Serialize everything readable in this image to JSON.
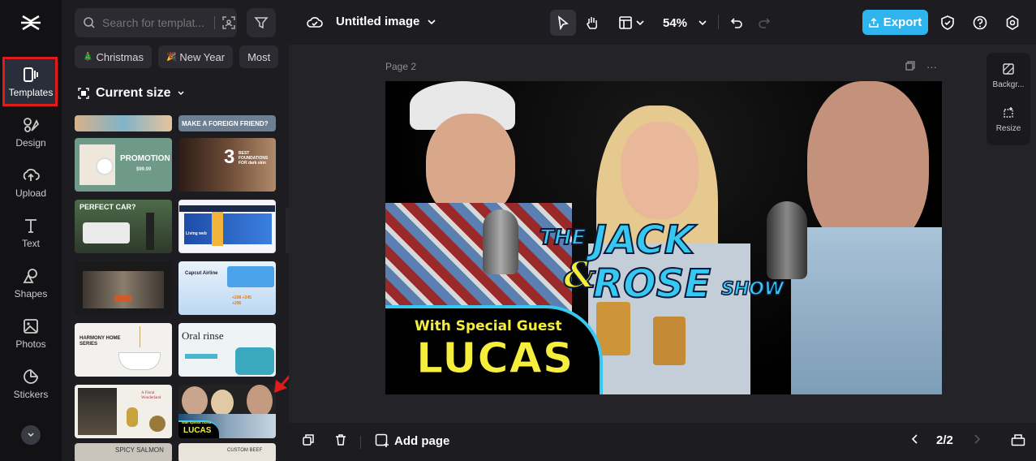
{
  "sidebar": {
    "items": [
      {
        "label": "Templates",
        "icon": "templates-icon"
      },
      {
        "label": "Design",
        "icon": "design-icon"
      },
      {
        "label": "Upload",
        "icon": "upload-icon"
      },
      {
        "label": "Text",
        "icon": "text-icon"
      },
      {
        "label": "Shapes",
        "icon": "shapes-icon"
      },
      {
        "label": "Photos",
        "icon": "photos-icon"
      },
      {
        "label": "Stickers",
        "icon": "stickers-icon"
      }
    ]
  },
  "panel": {
    "search_placeholder": "Search for templat...",
    "chips": [
      {
        "label": "Christmas",
        "emoji": "🎄"
      },
      {
        "label": "New Year",
        "emoji": "🎉"
      },
      {
        "label": "Most",
        "emoji": ""
      }
    ],
    "current_size": "Current size",
    "thumbnails": [
      {
        "text": "",
        "sub": ""
      },
      {
        "text": "MAKE A FOREIGN FRIEND?",
        "sub": ""
      },
      {
        "text": "PROMOTION",
        "sub": "$99.99"
      },
      {
        "text": "3",
        "sub": "BEST FOUNDATIONS FOR dark skin"
      },
      {
        "text": "PERFECT CAR?",
        "sub": ""
      },
      {
        "text": "Living web",
        "sub": ""
      },
      {
        "text": "",
        "sub": ""
      },
      {
        "text": "Capcut Airline",
        "sub": "+208 +245 +296"
      },
      {
        "text": "HARMONY HOME SERIES",
        "sub": ""
      },
      {
        "text": "Oral rinse",
        "sub": ""
      },
      {
        "text": "A Floral Wonderland",
        "sub": ""
      },
      {
        "text": "LUCAS",
        "sub": "With Special Guest"
      },
      {
        "text": "SPICY SALMON",
        "sub": ""
      },
      {
        "text": "CUSTOM BEEF",
        "sub": ""
      }
    ]
  },
  "topbar": {
    "title": "Untitled image",
    "zoom": "54%",
    "export_label": "Export"
  },
  "canvas": {
    "page_label": "Page 2",
    "artboard": {
      "title_the": "THE",
      "title_jack": "JACK",
      "title_amp": "&",
      "title_rose": "ROSE",
      "title_show": "SHOW",
      "guest_line": "With Special Guest",
      "guest_name": "LUCAS"
    },
    "side_tools": [
      {
        "label": "Backgr...",
        "icon": "background-icon"
      },
      {
        "label": "Resize",
        "icon": "resize-icon"
      }
    ]
  },
  "bottombar": {
    "add_page": "Add page",
    "page_counter": "2/2"
  },
  "colors": {
    "accent": "#2eb5ee",
    "highlight": "#e01b1b",
    "title_cyan": "#35c8f0",
    "guest_yellow": "#f5ee3c"
  }
}
